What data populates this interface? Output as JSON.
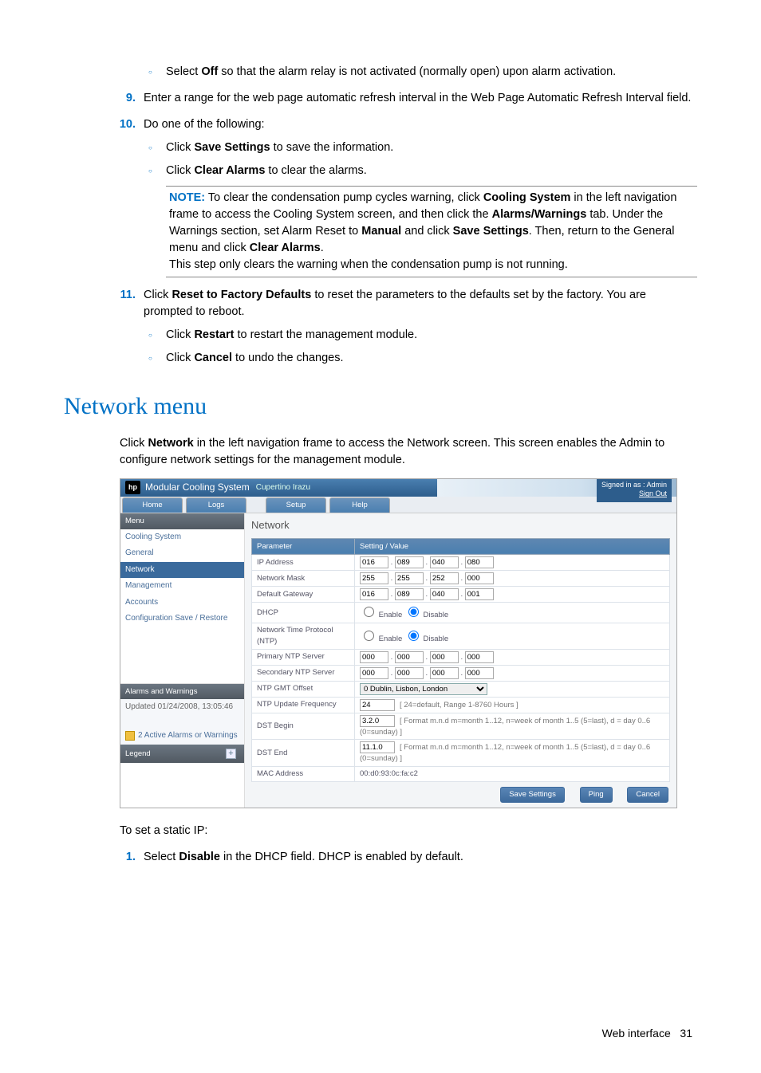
{
  "top": {
    "off_bullet": [
      "Select ",
      "Off",
      " so that the alarm relay is not activated (normally open) upon alarm activation."
    ],
    "step9_num": "9.",
    "step9": "Enter a range for the web page automatic refresh interval in the Web Page Automatic Refresh Interval field.",
    "step10_num": "10.",
    "step10": "Do one of the following:",
    "save_bullet": [
      "Click ",
      "Save Settings",
      " to save the information."
    ],
    "clear_bullet": [
      "Click ",
      "Clear Alarms",
      " to clear the alarms."
    ],
    "note": {
      "label": "NOTE:",
      "t1": "  To clear the condensation pump cycles warning, click ",
      "b1": "Cooling System",
      "t2": " in the left navigation frame to access the Cooling System screen, and then click the ",
      "b2": "Alarms/Warnings",
      "t3": " tab. Under the Warnings section, set Alarm Reset to ",
      "b3": "Manual",
      "t4": " and click ",
      "b4": "Save Settings",
      "t5": ". Then, return to the General menu and click ",
      "b5": "Clear Alarms",
      "t6": ".",
      "line2": "This step only clears the warning when the condensation pump is not running."
    },
    "step11_num": "11.",
    "step11": [
      "Click ",
      "Reset to Factory Defaults",
      " to reset the parameters to the defaults set by the factory. You are prompted to reboot."
    ],
    "restart_bullet": [
      "Click ",
      "Restart",
      " to restart the management module."
    ],
    "cancel_bullet": [
      "Click ",
      "Cancel",
      " to undo the changes."
    ]
  },
  "section_heading": "Network menu",
  "intro": [
    "Click ",
    "Network",
    " in the left navigation frame to access the Network screen. This screen enables the Admin to configure network settings for the management module."
  ],
  "shot": {
    "brand": "Modular Cooling System",
    "subtitle": "Cupertino Irazu",
    "signed_in": "Signed in as : Admin",
    "signout": "Sign Out",
    "tabs": [
      "Home",
      "Logs",
      "Setup",
      "Help"
    ],
    "menu_hdr": "Menu",
    "menu_items": [
      "Cooling System",
      "General",
      "Network",
      "Management",
      "Accounts",
      "Configuration Save / Restore"
    ],
    "menu_selected_index": 2,
    "alarms_hdr": "Alarms and Warnings",
    "updated": "Updated 01/24/2008, 13:05:46",
    "active_warn": "2 Active Alarms or Warnings",
    "legend": "Legend",
    "page_title": "Network",
    "col1": "Parameter",
    "col2": "Setting / Value",
    "rows": {
      "ip": {
        "label": "IP Address",
        "oct": [
          "016",
          "089",
          "040",
          "080"
        ]
      },
      "mask": {
        "label": "Network Mask",
        "oct": [
          "255",
          "255",
          "252",
          "000"
        ]
      },
      "gw": {
        "label": "Default Gateway",
        "oct": [
          "016",
          "089",
          "040",
          "001"
        ]
      },
      "dhcp": {
        "label": "DHCP",
        "enable": "Enable",
        "disable": "Disable",
        "sel": "disable"
      },
      "ntp": {
        "label": "Network Time Protocol (NTP)",
        "enable": "Enable",
        "disable": "Disable",
        "sel": "disable"
      },
      "pntp": {
        "label": "Primary NTP Server",
        "oct": [
          "000",
          "000",
          "000",
          "000"
        ]
      },
      "sntp": {
        "label": "Secondary NTP Server",
        "oct": [
          "000",
          "000",
          "000",
          "000"
        ]
      },
      "gmt": {
        "label": "NTP GMT Offset",
        "value": "0 Dublin, Lisbon, London"
      },
      "freq": {
        "label": "NTP Update Frequency",
        "value": "24",
        "hint": "[ 24=default, Range 1-8760 Hours ]"
      },
      "dstb": {
        "label": "DST Begin",
        "value": "3.2.0",
        "hint": "[ Format m.n.d m=month 1..12, n=week of month 1..5 (5=last), d = day 0..6 (0=sunday) ]"
      },
      "dste": {
        "label": "DST End",
        "value": "11.1.0",
        "hint": "[ Format m.n.d m=month 1..12, n=week of month 1..5 (5=last), d = day 0..6 (0=sunday) ]"
      },
      "mac": {
        "label": "MAC Address",
        "text": "00:d0:93:0c:fa:c2"
      }
    },
    "buttons": [
      "Save Settings",
      "Ping",
      "Cancel"
    ]
  },
  "after": {
    "para": "To set a static IP:",
    "step1_num": "1.",
    "step1": [
      "Select ",
      "Disable",
      " in the DHCP field. DHCP is enabled by default."
    ]
  },
  "footer": {
    "label": "Web interface",
    "page": "31"
  }
}
